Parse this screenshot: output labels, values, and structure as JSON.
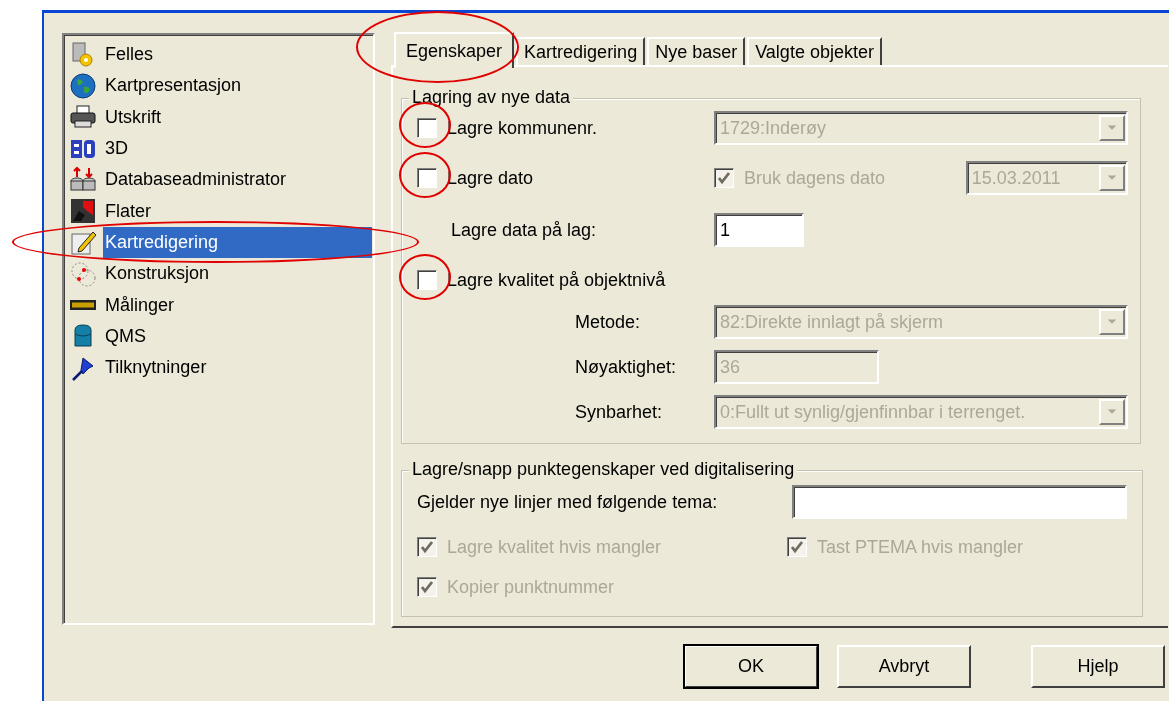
{
  "sidebar": {
    "items": [
      {
        "label": "Felles",
        "selected": false,
        "circled": false
      },
      {
        "label": "Kartpresentasjon",
        "selected": false,
        "circled": false
      },
      {
        "label": "Utskrift",
        "selected": false,
        "circled": false
      },
      {
        "label": "3D",
        "selected": false,
        "circled": false
      },
      {
        "label": "Databaseadministrator",
        "selected": false,
        "circled": false
      },
      {
        "label": "Flater",
        "selected": false,
        "circled": false
      },
      {
        "label": "Kartredigering",
        "selected": true,
        "circled": true
      },
      {
        "label": "Konstruksjon",
        "selected": false,
        "circled": false
      },
      {
        "label": "Målinger",
        "selected": false,
        "circled": false
      },
      {
        "label": "QMS",
        "selected": false,
        "circled": false
      },
      {
        "label": "Tilknytninger",
        "selected": false,
        "circled": false
      }
    ]
  },
  "tabs": [
    {
      "label": "Egenskaper",
      "selected": true,
      "circled": true
    },
    {
      "label": "Kartredigering",
      "selected": false,
      "circled": false
    },
    {
      "label": "Nye baser",
      "selected": false,
      "circled": false
    },
    {
      "label": "Valgte objekter",
      "selected": false,
      "circled": false
    }
  ],
  "storage_group": {
    "title": "Lagring av nye data",
    "save_municipality": {
      "label": "Lagre kommunenr.",
      "checked": false,
      "circled": true
    },
    "municipality": {
      "value": "1729:Inderøy",
      "disabled": true
    },
    "save_date": {
      "label": "Lagre dato",
      "checked": false,
      "circled": true
    },
    "use_today": {
      "label": "Bruk dagens dato",
      "checked": true,
      "disabled": true
    },
    "date": {
      "value": "15.03.2011",
      "disabled": true
    },
    "layer": {
      "label": "Lagre data på lag:",
      "value": "1"
    },
    "save_quality": {
      "label": "Lagre kvalitet på objektnivå",
      "checked": false,
      "circled": true
    },
    "method": {
      "label": "Metode:",
      "value": "82:Direkte innlagt på skjerm",
      "disabled": true
    },
    "accuracy": {
      "label": "Nøyaktighet:",
      "value": "36",
      "disabled": true
    },
    "visibility": {
      "label": "Synbarhet:",
      "value": "0:Fullt ut synlig/gjenfinnbar i terrenget.",
      "disabled": true
    }
  },
  "snap_group": {
    "title": "Lagre/snapp punktegenskaper ved digitalisering",
    "theme": {
      "label": "Gjelder nye linjer med følgende tema:"
    },
    "quality_if_missing": {
      "label": "Lagre kvalitet hvis mangler",
      "checked": true,
      "disabled": true
    },
    "ptema": {
      "label": "Tast PTEMA hvis mangler",
      "checked": true,
      "disabled": true
    },
    "copy_number": {
      "label": "Kopier punktnummer",
      "checked": true,
      "disabled": true
    }
  },
  "buttons": [
    {
      "label": "OK",
      "default": true
    },
    {
      "label": "Avbryt",
      "default": false
    },
    {
      "label": "Hjelp",
      "default": false
    }
  ]
}
